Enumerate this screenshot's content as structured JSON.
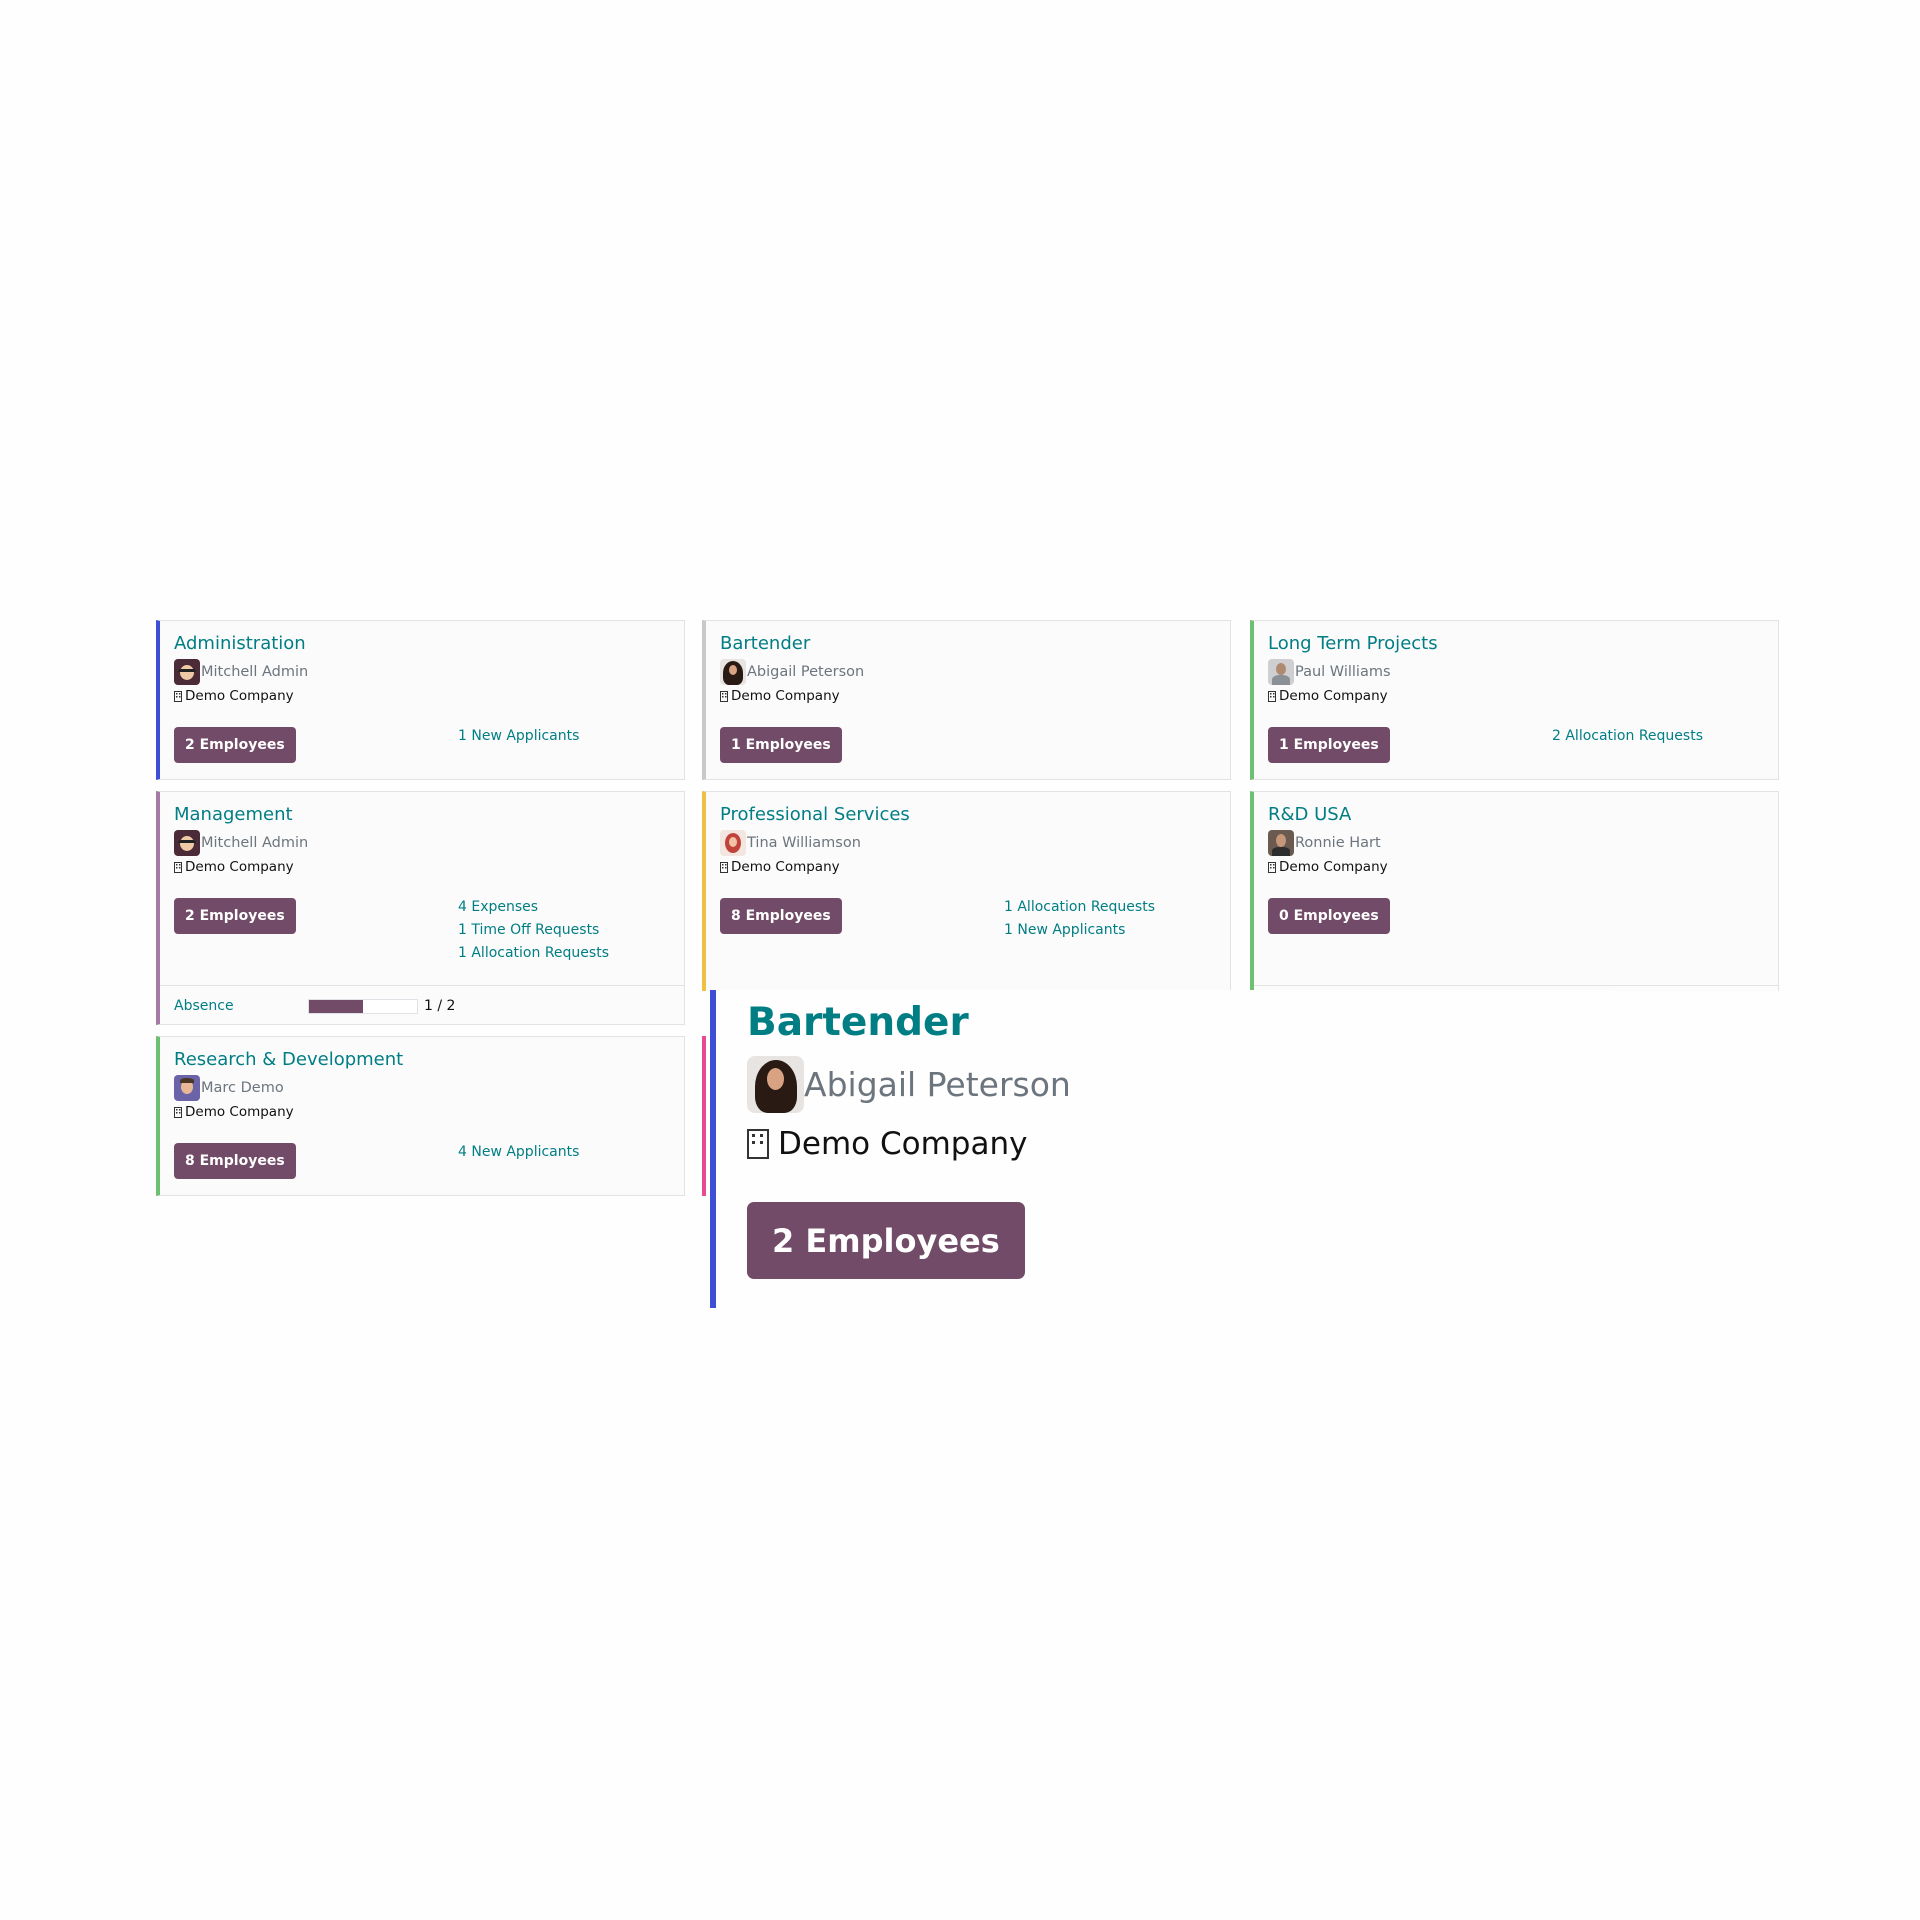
{
  "colors": {
    "title": "#017e84",
    "button": "#714b67",
    "accent_blue": "#3e4fd6",
    "accent_gray": "#c9c9c9",
    "accent_green": "#6cc070",
    "accent_purple": "#a57ba6",
    "accent_yellow": "#f0c040",
    "accent_pink": "#e84a8f"
  },
  "cards": {
    "administration": {
      "title": "Administration",
      "manager": "Mitchell Admin",
      "manager_avatar": "man-with-glasses-avatar",
      "company": "Demo Company",
      "employees_label": "2 Employees",
      "links": [
        "1 New Applicants"
      ]
    },
    "bartender": {
      "title": "Bartender",
      "manager": "Abigail Peterson",
      "manager_avatar": "woman-curly-hair-avatar",
      "company": "Demo Company",
      "employees_label": "1 Employees",
      "links": []
    },
    "long_term": {
      "title": "Long Term Projects",
      "manager": "Paul Williams",
      "manager_avatar": "man-avatar",
      "company": "Demo Company",
      "employees_label": "1 Employees",
      "links": [
        "2 Allocation Requests"
      ]
    },
    "management": {
      "title": "Management",
      "manager": "Mitchell Admin",
      "manager_avatar": "man-with-glasses-avatar",
      "company": "Demo Company",
      "employees_label": "2 Employees",
      "links": [
        "4 Expenses",
        "1 Time Off Requests",
        "1 Allocation Requests"
      ],
      "absence_label": "Absence",
      "absence_text": "1 / 2",
      "absence_value": 1,
      "absence_max": 2
    },
    "professional": {
      "title": "Professional Services",
      "manager": "Tina Williamson",
      "manager_avatar": "woman-red-hair-avatar",
      "company": "Demo Company",
      "employees_label": "8 Employees",
      "links": [
        "1 Allocation Requests",
        "1 New Applicants"
      ]
    },
    "rd_usa": {
      "title": "R&D USA",
      "manager": "Ronnie Hart",
      "manager_avatar": "man-beard-avatar",
      "company": "Demo Company",
      "employees_label": "0 Employees",
      "links": []
    },
    "research": {
      "title": "Research & Development",
      "manager": "Marc Demo",
      "manager_avatar": "man-avatar",
      "company": "Demo Company",
      "employees_label": "8 Employees",
      "links": [
        "4 New Applicants"
      ]
    }
  },
  "zoom": {
    "title": "Bartender",
    "manager": "Abigail Peterson",
    "company": "Demo Company",
    "employees_label": "2 Employees",
    "icons": [
      "woman-curly-hair-avatar",
      "building-icon"
    ]
  }
}
